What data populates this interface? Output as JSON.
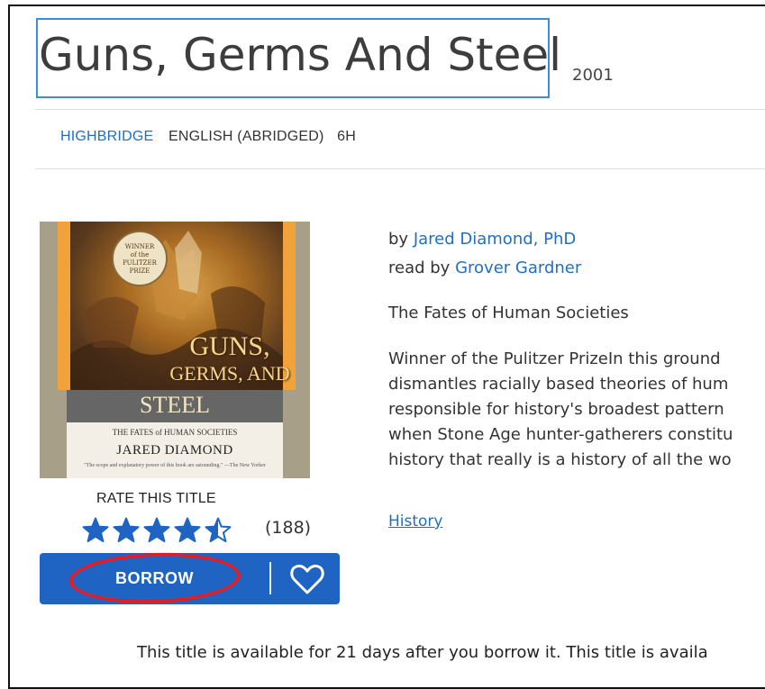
{
  "book": {
    "title": "Guns, Germs And Steel",
    "year": "2001",
    "publisher": "HIGHBRIDGE",
    "language": "ENGLISH (ABRIDGED)",
    "duration": "6H",
    "by_prefix": "by",
    "author": "Jared Diamond, PhD",
    "read_by_prefix": "read by",
    "narrator": "Grover Gardner",
    "subtitle": "The Fates of Human Societies",
    "description_lines": [
      "Winner of the Pulitzer PrizeIn this ground",
      "dismantles racially based theories of hum",
      "responsible for history's broadest pattern",
      "when Stone Age hunter-gatherers constitu",
      "history that really is a history of all the wo"
    ],
    "subject": "History",
    "availability": "This title is available for 21 days after you borrow it. This title is availa"
  },
  "cover": {
    "seal_lines": [
      "WINNER",
      "of the",
      "PULITZER",
      "PRIZE"
    ],
    "title_line1": "GUNS,",
    "title_line2": "GERMS, AND",
    "title_line3": "STEEL",
    "subtitle": "THE FATES of HUMAN SOCIETIES",
    "author": "JARED DIAMOND",
    "quote": "\"The scope and explanatory power of this book are astounding.\" —The New Yorker"
  },
  "rating": {
    "label": "RATE THIS TITLE",
    "count": "(188)",
    "value": 4.5,
    "max": 5,
    "star_color": "#1f64c2"
  },
  "actions": {
    "borrow_label": "BORROW",
    "wishlist_icon": "heart-icon",
    "accent": "#1f64c2"
  },
  "annotation": {
    "color": "#e51c23"
  }
}
